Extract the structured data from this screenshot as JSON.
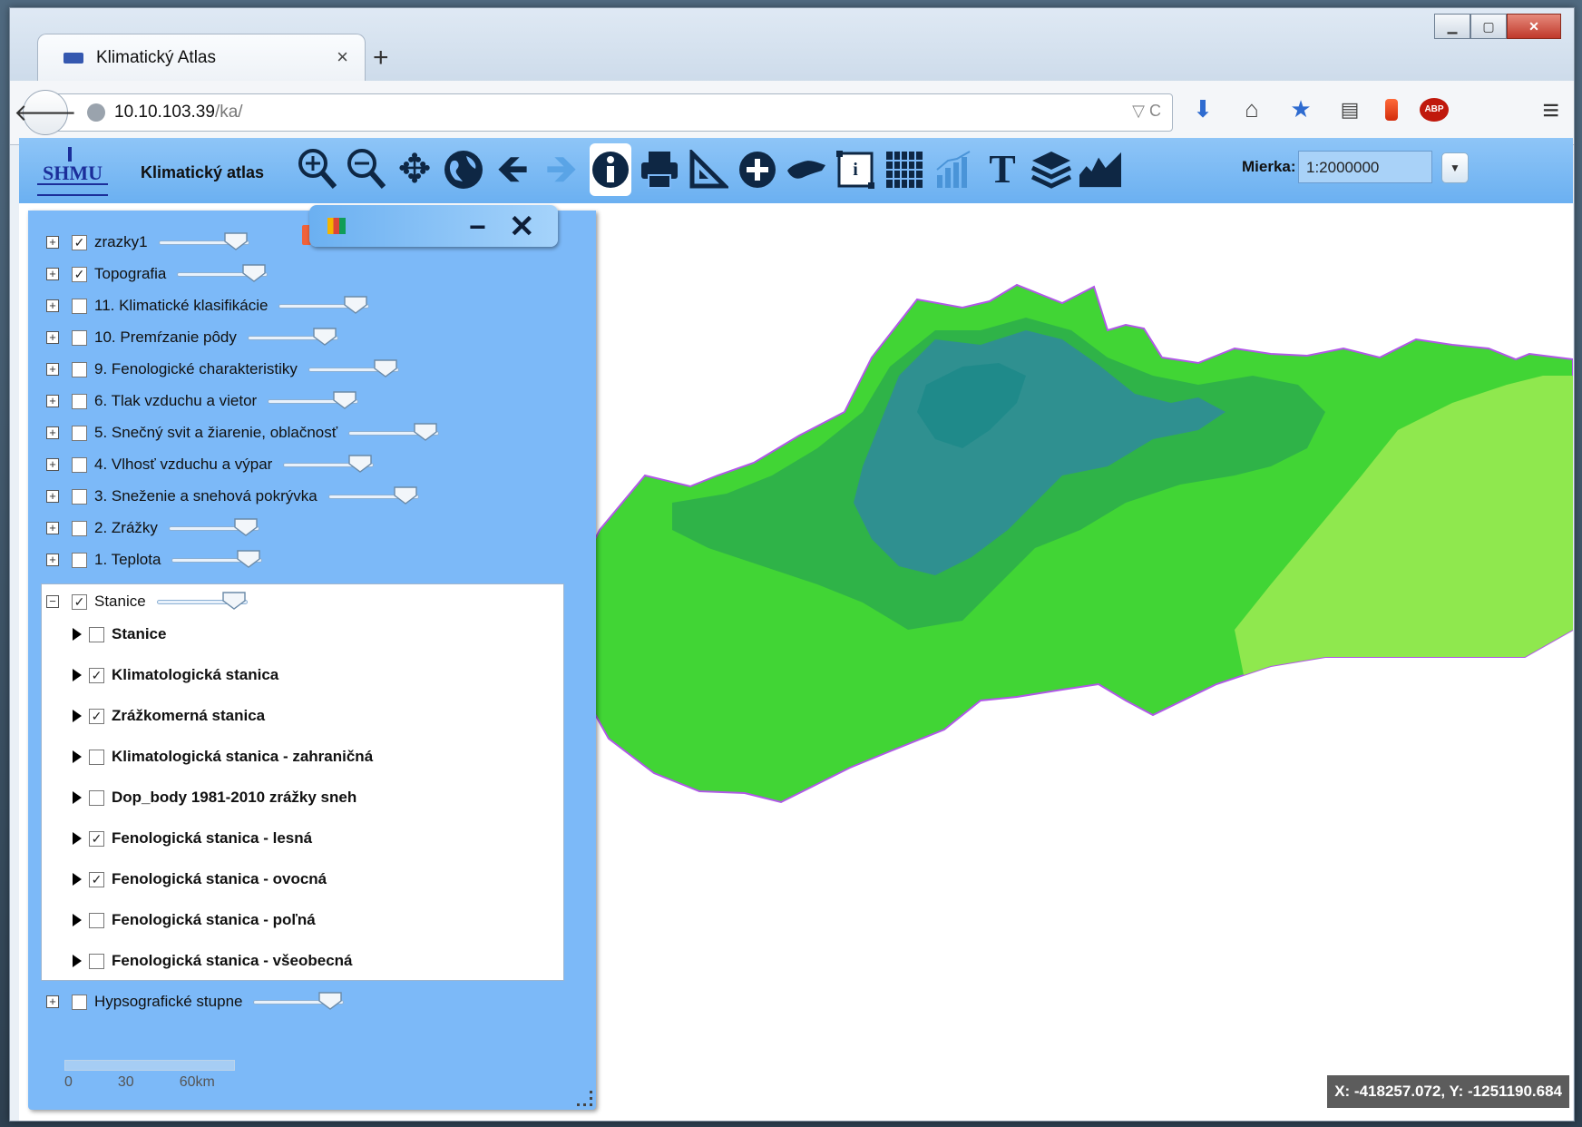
{
  "browser": {
    "tab_title": "Klimatický Atlas",
    "tab_close": "×",
    "new_tab": "+",
    "url_host": "10.10.103.39",
    "url_path": "/ka/",
    "url_tools": "▽ C"
  },
  "app": {
    "logo_text": "SHMU",
    "title": "Klimatický atlas",
    "scale_label": "Mierka:",
    "scale_value": "1:2000000"
  },
  "toolbar_icons": [
    "zoom-in-icon",
    "zoom-out-icon",
    "pan-icon",
    "globe-icon",
    "back-arrow-icon",
    "forward-arrow-icon",
    "info-icon",
    "print-icon",
    "measure-icon",
    "add-icon",
    "slovakia-map-icon",
    "legend-frame-icon",
    "grid-icon",
    "chart-icon",
    "text-icon",
    "layers-icon",
    "profile-icon"
  ],
  "layers": [
    {
      "label": "zrazky1",
      "checked": true,
      "opacity": 0.85
    },
    {
      "label": "Topografia",
      "checked": true,
      "opacity": 0.85
    },
    {
      "label": "11. Klimatické klasifikácie",
      "checked": false,
      "opacity": 0.85
    },
    {
      "label": "10. Premŕzanie pôdy",
      "checked": false,
      "opacity": 0.85
    },
    {
      "label": "9. Fenologické charakteristiky",
      "checked": false,
      "opacity": 0.85
    },
    {
      "label": "6. Tlak vzduchu a vietor",
      "checked": false,
      "opacity": 0.85
    },
    {
      "label": "5. Snečný svit a žiarenie, oblačnosť",
      "checked": false,
      "opacity": 0.85
    },
    {
      "label": "4. Vlhosť vzduchu a výpar",
      "checked": false,
      "opacity": 0.85
    },
    {
      "label": "3. Sneženie a snehová pokrývka",
      "checked": false,
      "opacity": 0.85
    },
    {
      "label": "2. Zrážky",
      "checked": false,
      "opacity": 0.85
    },
    {
      "label": "1. Teplota",
      "checked": false,
      "opacity": 0.85
    }
  ],
  "stanice": {
    "label": "Stanice",
    "checked": true,
    "opacity": 0.85,
    "children": [
      {
        "label": "Stanice",
        "checked": false
      },
      {
        "label": "Klimatologická stanica",
        "checked": true
      },
      {
        "label": "Zrážkomerná stanica",
        "checked": true
      },
      {
        "label": "Klimatologická stanica - zahraničná",
        "checked": false
      },
      {
        "label": "Dop_body 1981-2010 zrážky sneh",
        "checked": false
      },
      {
        "label": "Fenologická stanica - lesná",
        "checked": true
      },
      {
        "label": "Fenologická stanica - ovocná",
        "checked": true
      },
      {
        "label": "Fenologická stanica - poľná",
        "checked": false
      },
      {
        "label": "Fenologická stanica - všeobecná",
        "checked": false
      }
    ]
  },
  "hypso": {
    "label": "Hypsografické stupne",
    "checked": false,
    "opacity": 0.85
  },
  "scalebar": {
    "labels": [
      "0",
      "30",
      "60km"
    ]
  },
  "coords": "X: -418257.072, Y: -1251190.684",
  "colors": {
    "toolbar": "#7cb9f8",
    "panel": "#7cb9f8",
    "map_dark": "#2f9090",
    "map_mid": "#36c447",
    "map_light": "#8ee84a"
  }
}
